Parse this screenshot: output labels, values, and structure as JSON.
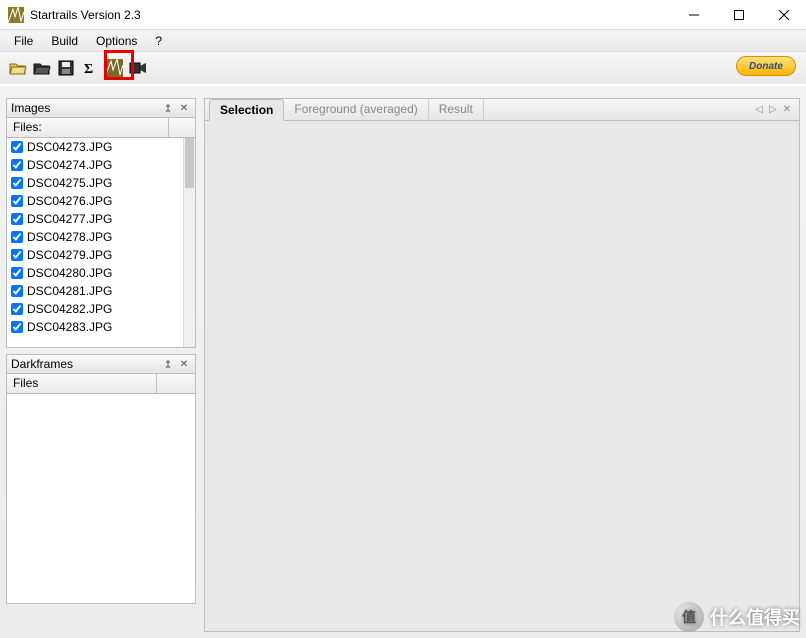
{
  "window": {
    "title": "Startrails Version 2.3",
    "minimize_label": "Minimize",
    "maximize_label": "Maximize",
    "close_label": "Close"
  },
  "menu": {
    "items": [
      "File",
      "Build",
      "Options",
      "?"
    ]
  },
  "toolbar": {
    "buttons": [
      {
        "name": "open-images-icon",
        "title": "Open Images"
      },
      {
        "name": "open-darkframes-icon",
        "title": "Open Darkframes"
      },
      {
        "name": "save-icon",
        "title": "Save"
      },
      {
        "name": "average-icon",
        "title": "Average"
      },
      {
        "name": "build-startrails-icon",
        "title": "Build Startrails"
      },
      {
        "name": "video-icon",
        "title": "Create Video"
      }
    ],
    "donate_label": "Donate",
    "highlighted_index": 4
  },
  "panels": {
    "images": {
      "title": "Images",
      "col_header": "Files:",
      "files": [
        {
          "checked": true,
          "name": "DSC04273.JPG"
        },
        {
          "checked": true,
          "name": "DSC04274.JPG"
        },
        {
          "checked": true,
          "name": "DSC04275.JPG"
        },
        {
          "checked": true,
          "name": "DSC04276.JPG"
        },
        {
          "checked": true,
          "name": "DSC04277.JPG"
        },
        {
          "checked": true,
          "name": "DSC04278.JPG"
        },
        {
          "checked": true,
          "name": "DSC04279.JPG"
        },
        {
          "checked": true,
          "name": "DSC04280.JPG"
        },
        {
          "checked": true,
          "name": "DSC04281.JPG"
        },
        {
          "checked": true,
          "name": "DSC04282.JPG"
        },
        {
          "checked": true,
          "name": "DSC04283.JPG"
        }
      ]
    },
    "darkframes": {
      "title": "Darkframes",
      "col_header": "Files"
    }
  },
  "tabs": {
    "items": [
      {
        "label": "Selection",
        "active": true
      },
      {
        "label": "Foreground (averaged)",
        "active": false
      },
      {
        "label": "Result",
        "active": false
      }
    ]
  },
  "watermark": {
    "text": "什么值得买"
  }
}
